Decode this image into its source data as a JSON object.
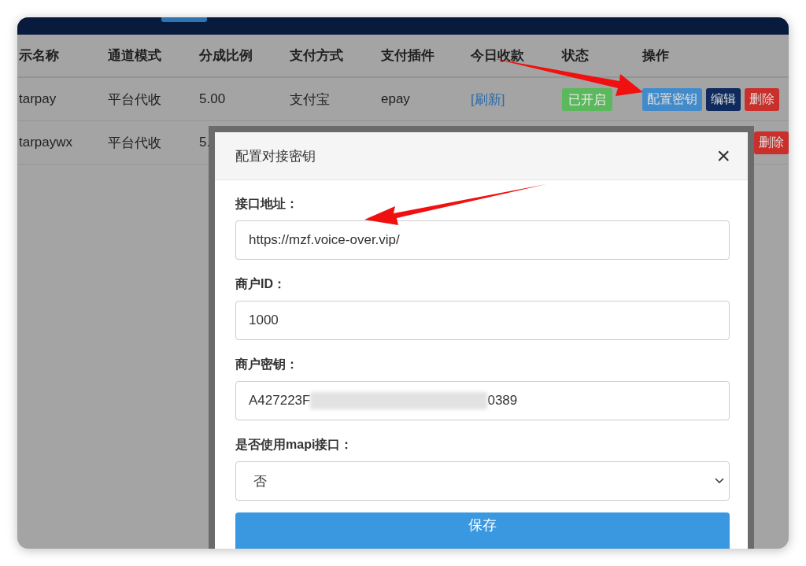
{
  "table": {
    "columns": [
      "示名称",
      "通道模式",
      "分成比例",
      "支付方式",
      "支付插件",
      "今日收款",
      "状态",
      "操作"
    ],
    "rows": [
      {
        "name": "tarpay",
        "mode": "平台代收",
        "ratio": "5.00",
        "method": "支付宝",
        "plugin": "epay",
        "today": "[刷新]",
        "status": {
          "label": "已开启",
          "color": "#5cb85c"
        },
        "actions": [
          "配置密钥",
          "编辑",
          "删除"
        ]
      },
      {
        "name": "tarpaywx",
        "mode": "平台代收",
        "ratio": "5.",
        "actions": [
          "删除"
        ]
      }
    ]
  },
  "modal": {
    "title": "配置对接密钥",
    "close": "×",
    "fields": [
      {
        "kind": "text",
        "label": "接口地址：",
        "value": "https://mzf.voice-over.vip/"
      },
      {
        "kind": "text",
        "label": "商户ID：",
        "value": "1000"
      },
      {
        "kind": "masked",
        "label": "商户密钥：",
        "value": "A427223F",
        "value_end": "0389"
      },
      {
        "kind": "select",
        "label": "是否使用mapi接口：",
        "value": "否"
      }
    ],
    "submit": "保存"
  }
}
